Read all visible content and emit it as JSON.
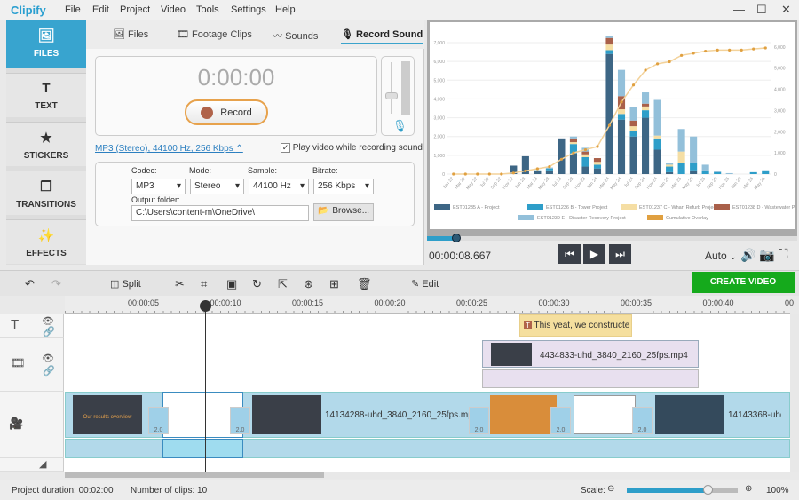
{
  "app": {
    "name": "Clipify"
  },
  "menu": [
    "File",
    "Edit",
    "Project",
    "Video",
    "Tools",
    "Settings",
    "Help"
  ],
  "window": {
    "minimize": "—",
    "maximize": "☐",
    "close": "✕"
  },
  "sidebar": [
    {
      "label": "FILES",
      "icon": "🖼"
    },
    {
      "label": "TEXT",
      "icon": "T"
    },
    {
      "label": "STICKERS",
      "icon": "★"
    },
    {
      "label": "TRANSITIONS",
      "icon": "❐"
    },
    {
      "label": "EFFECTS",
      "icon": "✨"
    }
  ],
  "tabs": [
    {
      "label": "Files",
      "icon": "🖼"
    },
    {
      "label": "Footage Clips",
      "icon": "🎞"
    },
    {
      "label": "Sounds",
      "icon": "〰"
    },
    {
      "label": "Record Sound",
      "icon": "🎙"
    }
  ],
  "record": {
    "timer": "0:00:00",
    "button": "Record",
    "format_link": "MP3 (Stereo), 44100 Hz, 256 Kbps",
    "play_video_label": "Play video while recording sound",
    "play_video_checked": true,
    "mic_level": 0.3
  },
  "settings": {
    "codec_label": "Codec:",
    "codec": "MP3",
    "mode_label": "Mode:",
    "mode": "Stereo",
    "sample_label": "Sample:",
    "sample": "44100 Hz",
    "bitrate_label": "Bitrate:",
    "bitrate": "256 Kbps",
    "output_label": "Output folder:",
    "output": "C:\\Users\\content-m\\OneDrive\\",
    "browse": "Browse..."
  },
  "player": {
    "time": "00:00:08.667",
    "quality": "Auto",
    "progress": 0.08
  },
  "chart_data": {
    "type": "bar",
    "title": "",
    "left_ticks": [
      "0",
      "1,000",
      "2,000",
      "3,000",
      "4,000",
      "5,000",
      "6,000",
      "7,000"
    ],
    "right_ticks": [
      "0",
      "1,000",
      "2,000",
      "3,000",
      "4,000",
      "5,000",
      "6,000"
    ],
    "categories": [
      "Jan 22",
      "Mar 22",
      "May 22",
      "Jul 22",
      "Sep 22",
      "Nov 22",
      "Jan 23",
      "Mar 23",
      "May 23",
      "Jul 23",
      "Sep 23",
      "Nov 23",
      "Jan 24",
      "Mar 24",
      "May 24",
      "Jul 24",
      "Sep 24",
      "Nov 24",
      "Jan 25",
      "Mar 25",
      "May 25",
      "Jul 25",
      "Sep 25",
      "Nov 25",
      "Jan 26",
      "Mar 26",
      "May 26"
    ],
    "series": [
      {
        "name": "EST01235 A - Project",
        "color": "#3d6685",
        "values": [
          0,
          0,
          0,
          0,
          0,
          450,
          950,
          150,
          200,
          1900,
          1100,
          400,
          300,
          6400,
          2900,
          2000,
          3000,
          1300,
          100,
          0,
          200,
          0,
          0,
          0,
          0,
          0,
          0
        ]
      },
      {
        "name": "EST01236 B - Tower Project",
        "color": "#2e9ec9",
        "values": [
          0,
          0,
          0,
          0,
          0,
          0,
          0,
          50,
          100,
          0,
          500,
          500,
          200,
          200,
          300,
          300,
          400,
          600,
          300,
          600,
          400,
          200,
          100,
          0,
          0,
          100,
          200
        ]
      },
      {
        "name": "EST01237 C - Wharf Refurb Project",
        "color": "#f5dea4",
        "values": [
          0,
          0,
          0,
          0,
          0,
          0,
          0,
          0,
          0,
          0,
          100,
          150,
          150,
          300,
          250,
          250,
          200,
          150,
          100,
          600,
          0,
          0,
          0,
          0,
          0,
          0,
          0
        ]
      },
      {
        "name": "EST01238 D - Wastewater Project",
        "color": "#a9604a",
        "values": [
          0,
          0,
          0,
          0,
          0,
          0,
          0,
          0,
          0,
          0,
          200,
          150,
          200,
          350,
          700,
          300,
          150,
          0,
          0,
          0,
          0,
          0,
          0,
          0,
          0,
          0,
          0
        ]
      },
      {
        "name": "EST01239 E - Disaster Recovery Project",
        "color": "#93c0da",
        "values": [
          0,
          0,
          0,
          0,
          0,
          0,
          0,
          0,
          50,
          0,
          100,
          200,
          0,
          100,
          1400,
          700,
          600,
          1900,
          100,
          1200,
          1400,
          300,
          50,
          50,
          0,
          0,
          0
        ]
      }
    ],
    "cumulative": {
      "name": "Cumulative Overlay",
      "color": "#e0a040",
      "values": [
        0,
        0,
        0,
        0,
        0,
        50,
        150,
        250,
        350,
        700,
        1000,
        1150,
        1300,
        2300,
        3400,
        4200,
        4900,
        5200,
        5300,
        5600,
        5700,
        5800,
        5850,
        5850,
        5850,
        5900,
        5950
      ]
    },
    "ylim_left": [
      0,
      7000
    ],
    "ylim_right": [
      0,
      6200
    ],
    "legend": "bottom"
  },
  "toolbar": {
    "split": "Split",
    "edit": "Edit",
    "create": "CREATE VIDEO"
  },
  "ruler": [
    "00:00:05",
    "00:00:10",
    "00:00:15",
    "00:00:20",
    "00:00:25",
    "00:00:30",
    "00:00:35",
    "00:00:40",
    "00"
  ],
  "timeline": {
    "text_clip": "This yeat, we constructe",
    "overlay_clip": "4434833-uhd_3840_2160_25fps.mp4",
    "main_clip1": "14134288-uhd_3840_2160_25fps.mp4",
    "main_clip2": "14143368-uhd",
    "title_clip": "Our results overview",
    "transition": "2.0"
  },
  "status": {
    "duration": "Project duration:  00:02:00",
    "clips": "Number of clips: 10",
    "scale_label": "Scale:",
    "zoom": "100%",
    "scale_value": 0.73
  }
}
